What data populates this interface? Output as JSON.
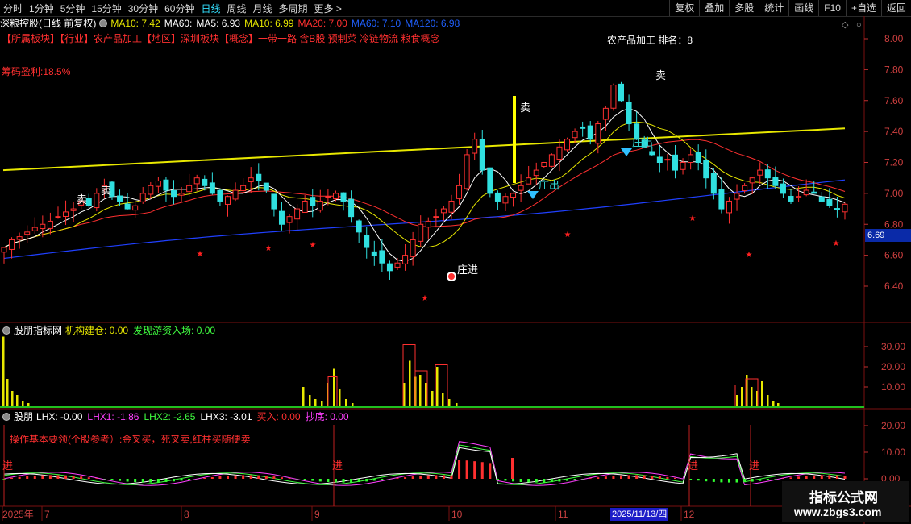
{
  "toolbar": {
    "items": [
      "分时",
      "1分钟",
      "5分钟",
      "15分钟",
      "30分钟",
      "60分钟",
      "日线",
      "周线",
      "月线",
      "多周期",
      "更多 >"
    ],
    "active_index": 6,
    "right_items": [
      "复权",
      "叠加",
      "多股",
      "统计",
      "画线",
      "F10",
      "+自选",
      "返回"
    ]
  },
  "main_panel": {
    "title": "深粮控股(日线 前复权)",
    "ma_labels": [
      {
        "text": "MA10: 7.42",
        "color": "#e8e800"
      },
      {
        "text": "MA60:",
        "color": "#ffffff"
      },
      {
        "text": "MA5: 6.93",
        "color": "#ffffff"
      },
      {
        "text": "MA10: 6.99",
        "color": "#e8e800"
      },
      {
        "text": "MA20: 7.00",
        "color": "#ff3030"
      },
      {
        "text": "MA60: 7.10",
        "color": "#2060ff"
      },
      {
        "text": "MA120: 6.98",
        "color": "#2060ff"
      }
    ],
    "sector_line": "【所属板块】【行业】农产品加工【地区】深圳板块【概念】一带一路 含B股 预制菜 冷链物流 粮食概念",
    "rank_label": "农产品加工 排名：8",
    "chip_profit": "筹码盈利:18.5%",
    "price_tag": "6.69",
    "y_ticks": [
      "8.00",
      "7.80",
      "7.60",
      "7.40",
      "7.20",
      "7.00",
      "6.80",
      "6.60",
      "6.40"
    ],
    "annotations": {
      "sell": "卖",
      "zhuang_in": "庄进",
      "zhuang_out": "庄出"
    }
  },
  "panel2": {
    "title": "股朋指标网",
    "labels": [
      {
        "text": "机构建仓: 0.00",
        "color": "#e8e800"
      },
      {
        "text": "发现游资入场: 0.00",
        "color": "#40ff40"
      }
    ],
    "y_ticks": [
      "30.00",
      "20.00",
      "10.00"
    ]
  },
  "panel3": {
    "title": "股朋",
    "labels": [
      {
        "text": "LHX: -0.00",
        "color": "#ffffff"
      },
      {
        "text": "LHX1: -1.86",
        "color": "#ff40ff"
      },
      {
        "text": "LHX2: -2.65",
        "color": "#40ff40"
      },
      {
        "text": "LHX3: -3.01",
        "color": "#ffffff"
      },
      {
        "text": "买入: 0.00",
        "color": "#ff3030"
      },
      {
        "text": "抄底: 0.00",
        "color": "#ff40ff"
      }
    ],
    "note": "操作基本要领(个股参考）:金叉买，死叉卖,红柱买随便卖",
    "y_ticks": [
      "20.00",
      "10.00",
      "0.00"
    ],
    "annotations": {
      "jin": "进"
    }
  },
  "x_axis": {
    "labels": [
      "2025年",
      "7",
      "8",
      "9",
      "10",
      "11",
      "12"
    ],
    "date_tag": "2025/11/13/四"
  },
  "watermark": {
    "title": "指标公式网",
    "url": "www.zbgs3.com"
  },
  "colors": {
    "up": "#ff3030",
    "down": "#30e0e0",
    "yellow": "#e8e800",
    "blue": "#2040ff"
  }
}
